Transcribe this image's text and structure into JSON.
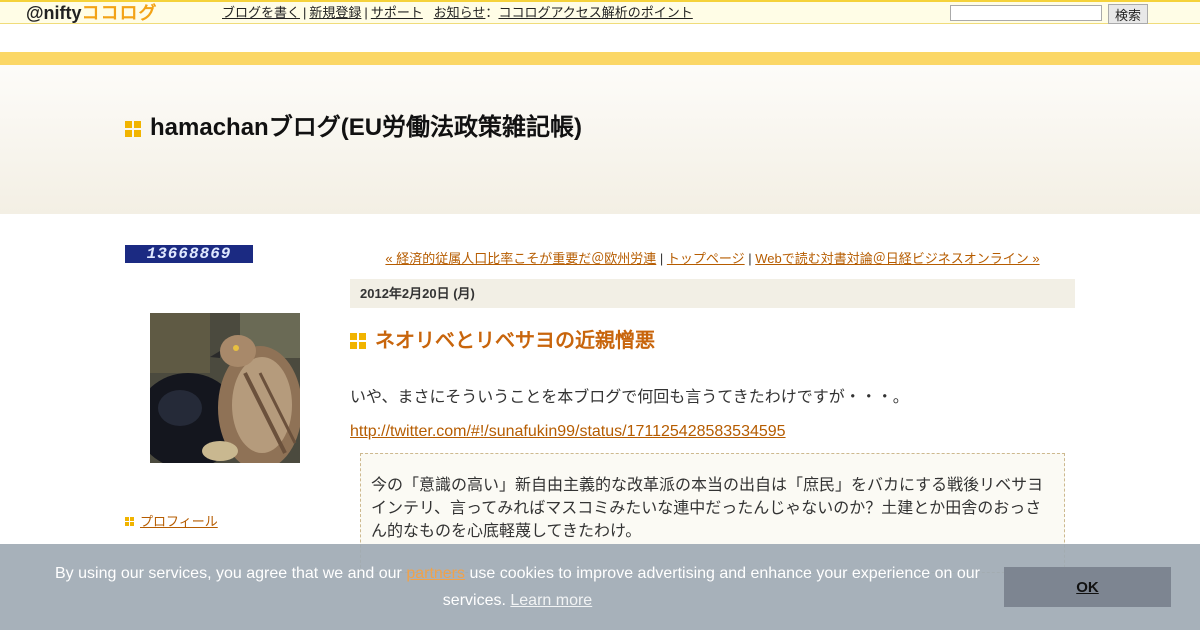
{
  "topbar": {
    "logo_at": "@nifty",
    "logo_cocolog": "ココログ",
    "nav": {
      "write": "ブログを書く",
      "register": "新規登録",
      "support": "サポート",
      "notice_label": "お知らせ",
      "notice_colon": "：",
      "notice_link": "ココログアクセス解析のポイント"
    },
    "search_placeholder": "",
    "search_button": "検索"
  },
  "blog": {
    "title": "hamachanブログ(EU労働法政策雑記帳)"
  },
  "sidebar": {
    "counter": "13668869",
    "profile_link": "プロフィール"
  },
  "post_nav": {
    "prev": "« 経済的従属人口比率こそが重要だ＠欧州労連",
    "sep1": " | ",
    "top": "トップページ",
    "sep2": " | ",
    "next": "Webで読む対書対論＠日経ビジネスオンライン »"
  },
  "entry": {
    "date": "2012年2月20日 (月)",
    "title": "ネオリベとリベサヨの近親憎悪",
    "body": "いや、まさにそういうことを本ブログで何回も言うてきたわけですが・・・。",
    "tweet_url": "http://twitter.com/#!/sunafukin99/status/171125428583534595",
    "quote": "今の「意識の高い」新自由主義的な改革派の本当の出自は「庶民」をバカにする戦後リベサヨインテリ、言ってみればマスコミみたいな連中だったんじゃないのか？土建とか田舎のおっさん的なものを心底軽蔑してきたわけ。"
  },
  "cookie": {
    "text_before": "By using our services, you agree that we and our ",
    "partners": "partners",
    "text_after": " use cookies to improve advertising and enhance your experience on our services. ",
    "learn_more": "Learn more",
    "ok": "OK"
  },
  "colors": {
    "accent_orange": "#c8650c",
    "link": "#b65c00",
    "icon_yellow": "#f1b400"
  }
}
